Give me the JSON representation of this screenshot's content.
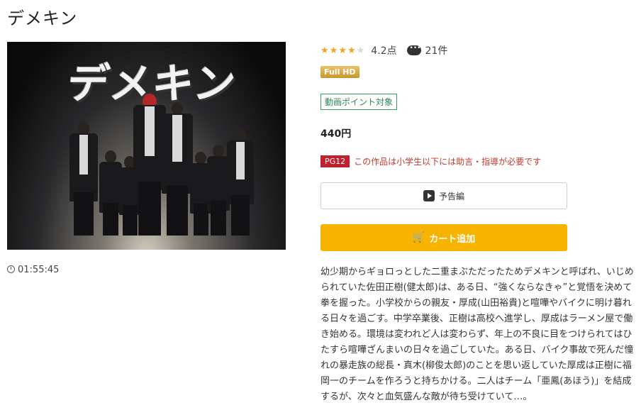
{
  "title": "デメキン",
  "poster": {
    "title_text": "デメキン"
  },
  "duration": "01:55:45",
  "rating": {
    "stars_filled": 4,
    "stars_total": 5,
    "score": "4.2点",
    "reviews": "21件",
    "star_color": "#f3a61e"
  },
  "badges": {
    "quality": "Full HD",
    "point": "動画ポイント対象"
  },
  "price": "440円",
  "pg": {
    "label": "PG12",
    "text": "この作品は小学生以下には助言・指導が必要です"
  },
  "buttons": {
    "trailer": "予告編",
    "cart": "カート追加"
  },
  "description": "幼少期からギョロっとした二重まぶただったためデメキンと呼ばれ、いじめられていた佐田正樹(健太郎)は、ある日、“強くならなきゃ”と覚悟を決めて拳を握った。小学校からの親友・厚成(山田裕貴)と喧嘩やバイクに明け暮れる日々を過ごす。中学卒業後、正樹は高校へ進学し、厚成はラーメン屋で働き始める。環境は変われど人は変わらず、年上の不良に目をつけられてはひたすら喧嘩ざんまいの日々を過ごしていた。ある日、バイク事故で死んだ憧れの暴走族の総長・真木(柳俊太郎)のことを思い返していた厚成は正樹に福岡一のチームを作ろうと持ちかける。二人はチーム「亜鳳(あほう)」を結成するが、次々と血気盛んな敵が待ち受けていて…。",
  "colors": {
    "accent": "#f6b300",
    "pg_red": "#c0212f",
    "point_green": "#3a9a63"
  }
}
